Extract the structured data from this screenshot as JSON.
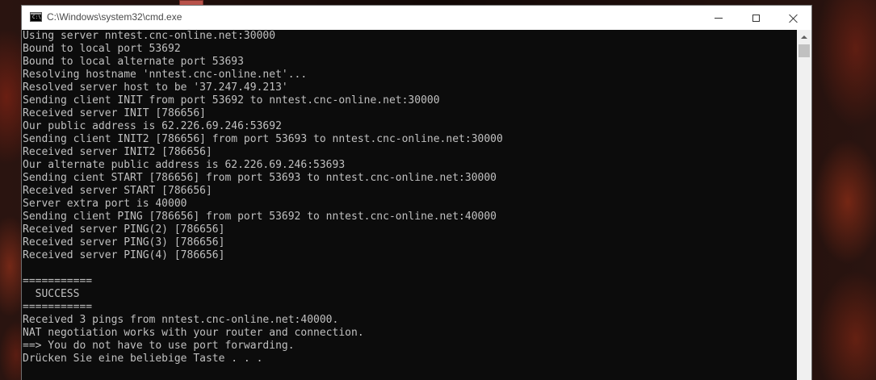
{
  "window": {
    "title": "C:\\Windows\\system32\\cmd.exe",
    "app_icon_prompt": "C:\\",
    "buttons": {
      "minimize": "minimize-icon",
      "maximize": "maximize-icon",
      "close": "close-icon"
    }
  },
  "console": {
    "background": "#0c0c0c",
    "foreground": "#c0c0c0",
    "lines": [
      "Using server nntest.cnc-online.net:30000",
      "Bound to local port 53692",
      "Bound to local alternate port 53693",
      "Resolving hostname 'nntest.cnc-online.net'...",
      "Resolved server host to be '37.247.49.213'",
      "Sending client INIT from port 53692 to nntest.cnc-online.net:30000",
      "Received server INIT [786656]",
      "Our public address is 62.226.69.246:53692",
      "Sending client INIT2 [786656] from port 53693 to nntest.cnc-online.net:30000",
      "Received server INIT2 [786656]",
      "Our alternate public address is 62.226.69.246:53693",
      "Sending cient START [786656] from port 53693 to nntest.cnc-online.net:30000",
      "Received server START [786656]",
      "Server extra port is 40000",
      "Sending client PING [786656] from port 53692 to nntest.cnc-online.net:40000",
      "Received server PING(2) [786656]",
      "Received server PING(3) [786656]",
      "Received server PING(4) [786656]",
      "",
      "===========",
      "  SUCCESS",
      "===========",
      "Received 3 pings from nntest.cnc-online.net:40000.",
      "NAT negotiation works with your router and connection.",
      "==> You do not have to use port forwarding.",
      "Drücken Sie eine beliebige Taste . . ."
    ]
  }
}
